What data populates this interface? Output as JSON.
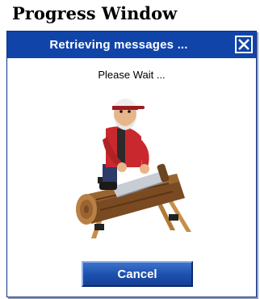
{
  "page": {
    "heading": "Progress Window"
  },
  "dialog": {
    "title": "Retrieving messages ...",
    "status_text": "Please Wait ...",
    "cancel_label": "Cancel",
    "illustration": "lumberjack-sawing-log-animation"
  },
  "colors": {
    "title_bar": "#1044a8",
    "button": "#1c4fad",
    "window_border": "#0b2f86"
  }
}
